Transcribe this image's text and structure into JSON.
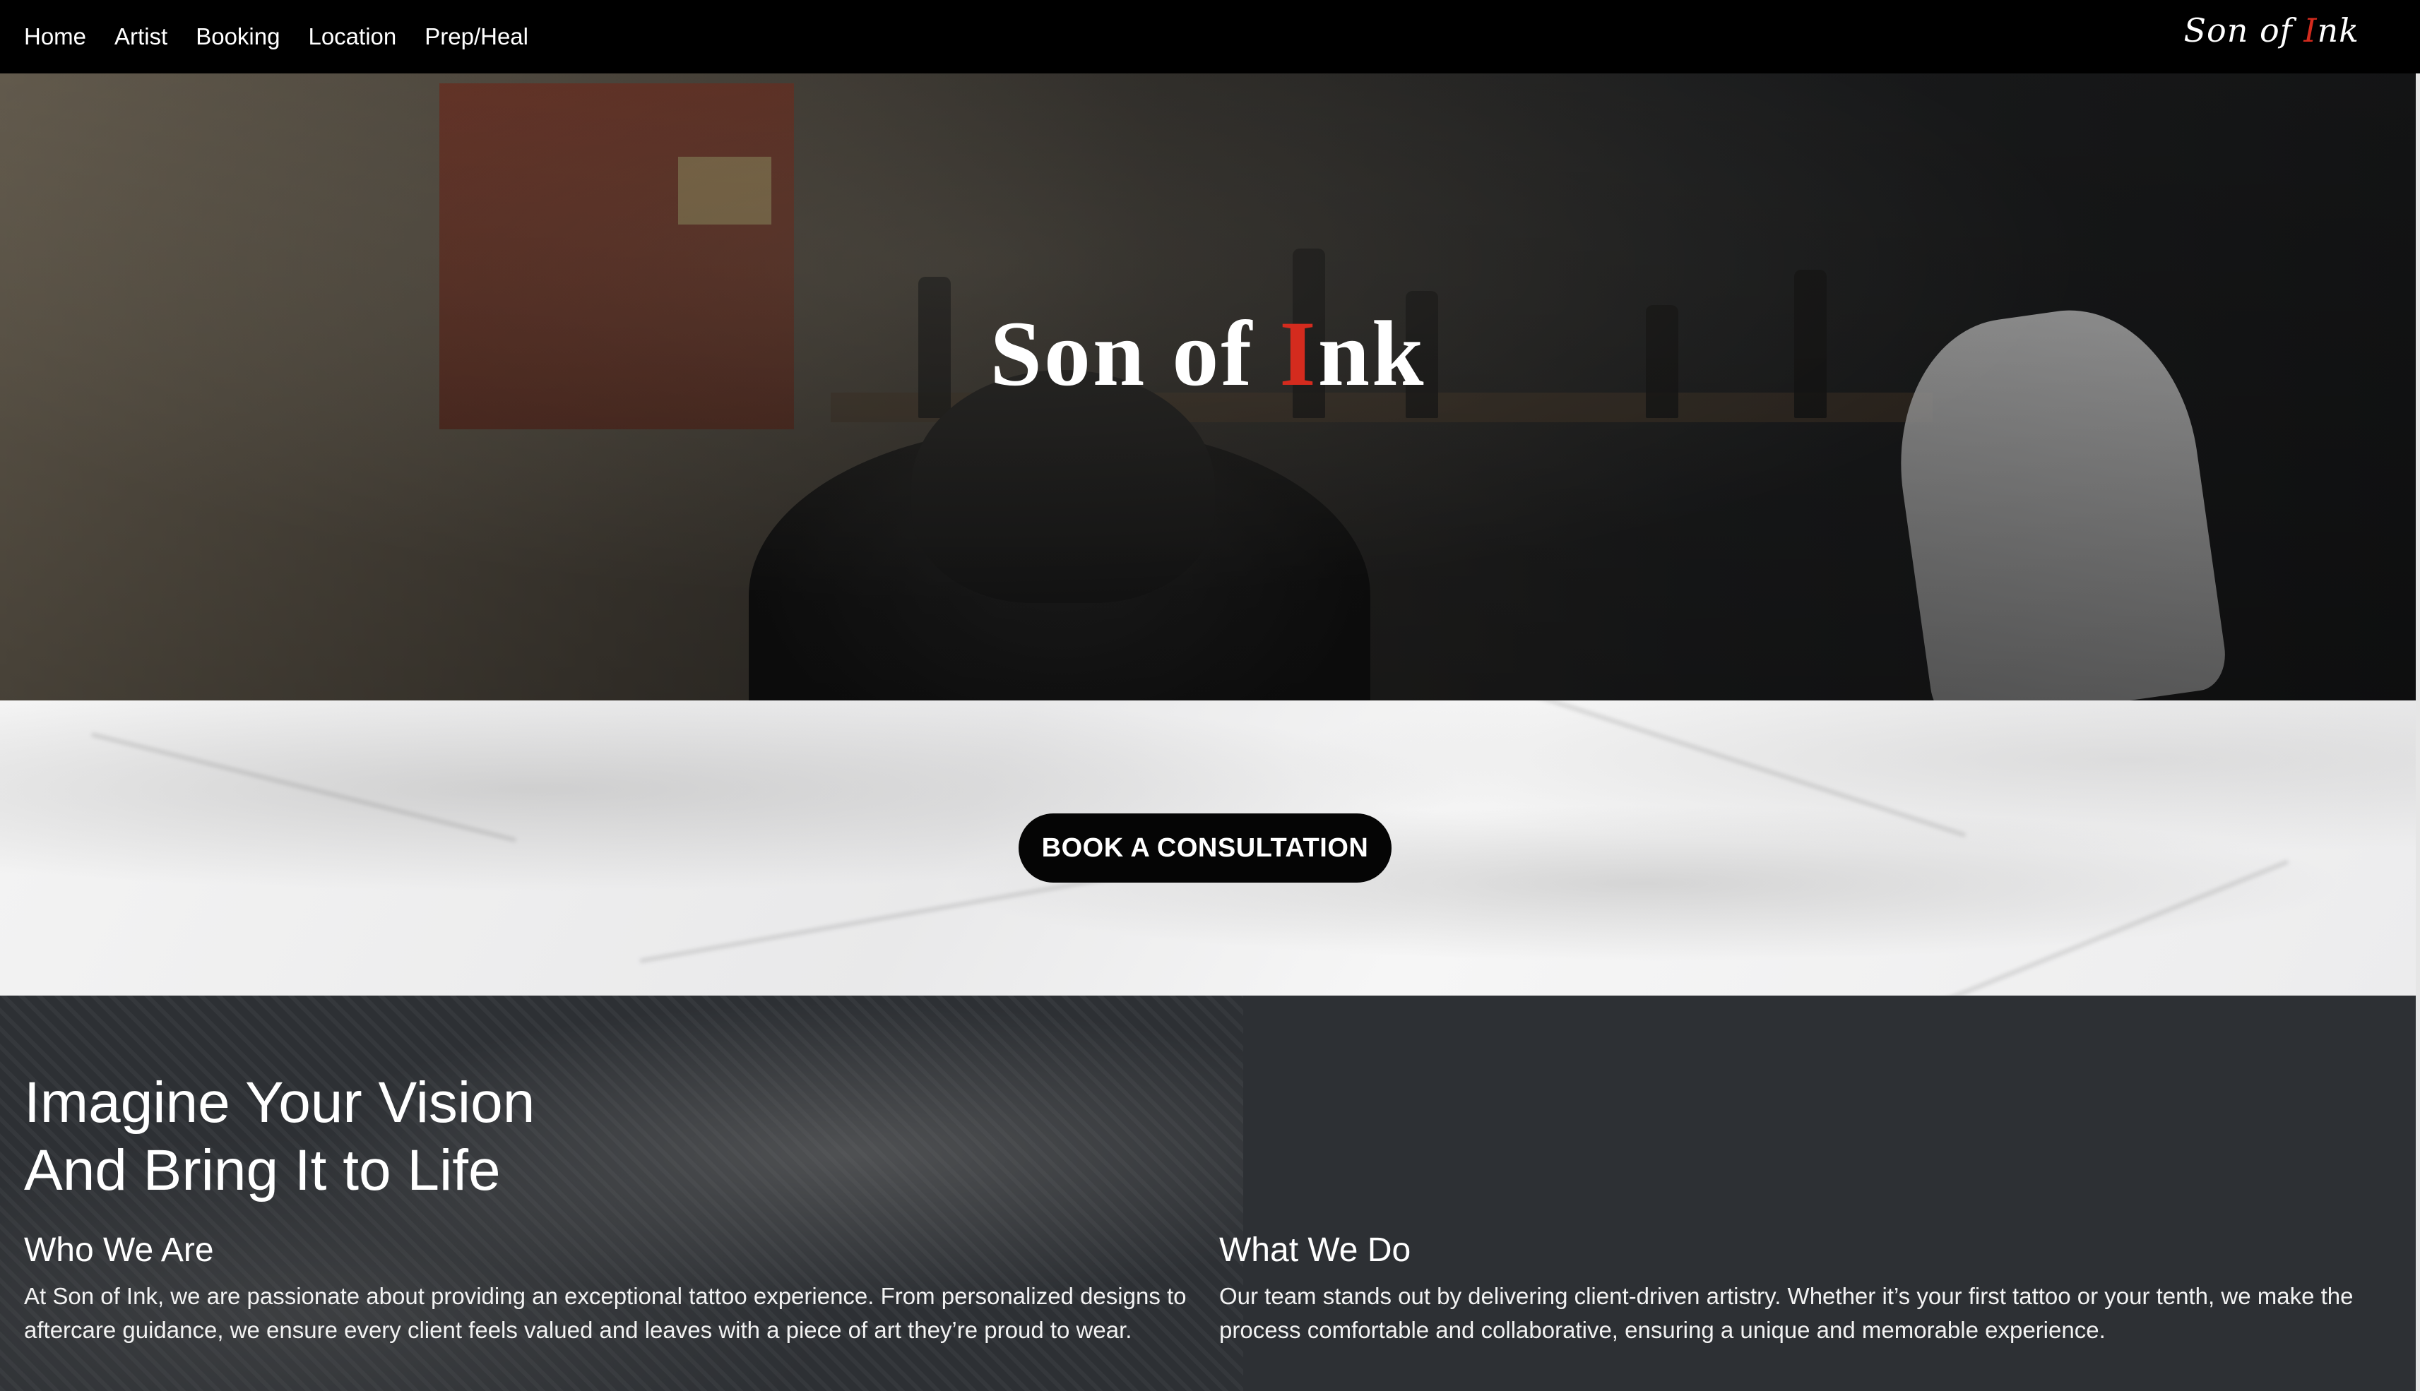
{
  "nav": {
    "links": [
      "Home",
      "Artist",
      "Booking",
      "Location",
      "Prep/Heal"
    ],
    "brand": {
      "pre": "Son of ",
      "accent": "I",
      "post": "nk"
    }
  },
  "hero": {
    "title": {
      "pre": "Son of ",
      "accent": "I",
      "post": "nk"
    }
  },
  "cta": {
    "label": "BOOK A CONSULTATION"
  },
  "about": {
    "heading_line1": "Imagine Your Vision",
    "heading_line2": "And Bring It to Life",
    "who": {
      "title": "Who We Are",
      "text": "At Son of Ink, we are passionate about providing an exceptional tattoo experience. From personalized designs to aftercare guidance, we ensure every client feels valued and leaves with a piece of art they’re proud to wear."
    },
    "what": {
      "title": "What We Do",
      "text": "Our team stands out by delivering client-driven artistry. Whether it’s your first tattoo or your tenth, we make the process comfortable and collaborative, ensuring a unique and memorable experience."
    }
  },
  "colors": {
    "accent": "#d42b1e",
    "navbar": "#000000",
    "button": "#050505",
    "section_dark": "#2d3034"
  }
}
